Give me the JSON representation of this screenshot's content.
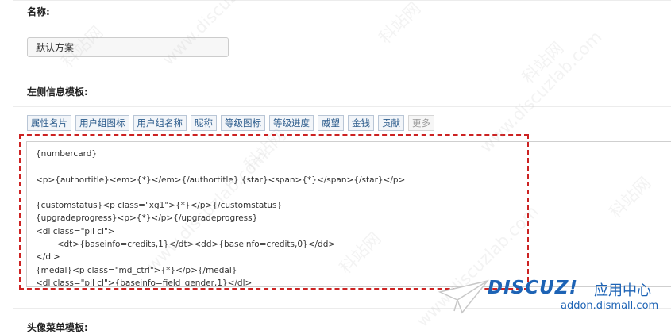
{
  "form": {
    "name_label": "名称:",
    "name_value": "默认方案",
    "left_template_label": "左侧信息模板:",
    "next_section_label": "头像菜单模板:"
  },
  "toolbar": {
    "buttons": [
      "属性名片",
      "用户组图标",
      "用户组名称",
      "昵称",
      "等级图标",
      "等级进度",
      "威望",
      "金钱",
      "贡献",
      "更多"
    ]
  },
  "editor": {
    "content": "{numbercard}\n\n<p>{authortitle}<em>{*}</em>{/authortitle} {star}<span>{*}</span>{/star}</p>\n\n{customstatus}<p class=\"xg1\">{*}</p>{/customstatus}\n{upgradeprogress}<p>{*}</p>{/upgradeprogress}\n<dl class=\"pil cl\">\n        <dt>{baseinfo=credits,1}</dt><dd>{baseinfo=credits,0}</dd>\n</dl>\n{medal}<p class=\"md_ctrl\">{*}</p>{/medal}\n<dl class=\"pil cl\">{baseinfo=field_gender,1}</dl>"
  },
  "watermark": {
    "site_cn": "科站网",
    "site_url": "www.discuzlab.com",
    "logo_word": "DISCUZ!",
    "logo_cn": "应用中心",
    "logo_url": "addon.dismall.com"
  },
  "colors": {
    "highlight_border": "#cc2222",
    "button_text": "#2b5b8c",
    "logo_blue": "#1d63b5"
  }
}
